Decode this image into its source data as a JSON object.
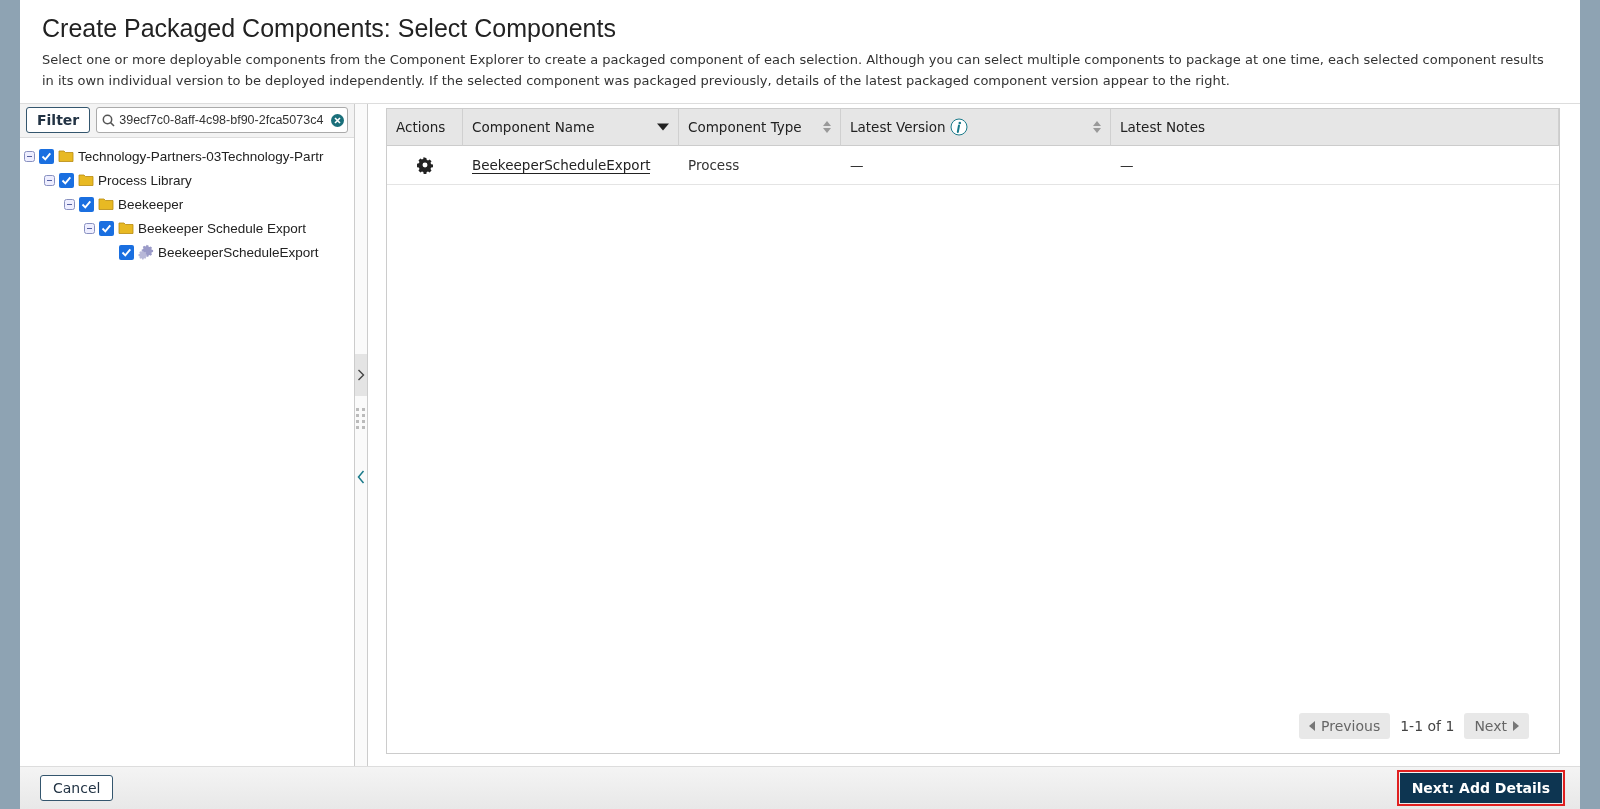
{
  "dialog": {
    "title": "Create Packaged Components: Select Components",
    "description": "Select one or more deployable components from the Component Explorer to create a packaged component of each selection. Although you can select multiple components to package at one time, each selected component results in its own individual version to be deployed independently. If the selected component was packaged previously, details of the latest packaged component version appear to the right."
  },
  "explorer": {
    "filter_button": "Filter",
    "search": {
      "value": "39ecf7c0-8aff-4c98-bf90-2fca5073c4"
    },
    "tree": [
      {
        "label": "Technology-Partners-03Technology-Partr",
        "kind": "folder",
        "checked": true,
        "expanded": true,
        "children": [
          {
            "label": "Process Library",
            "kind": "folder",
            "checked": true,
            "expanded": true,
            "children": [
              {
                "label": "Beekeeper",
                "kind": "folder",
                "checked": true,
                "expanded": true,
                "children": [
                  {
                    "label": "Beekeeper Schedule Export",
                    "kind": "folder",
                    "checked": true,
                    "expanded": true,
                    "children": [
                      {
                        "label": "BeekeeperScheduleExport",
                        "kind": "process",
                        "checked": true,
                        "expanded": false
                      }
                    ]
                  }
                ]
              }
            ]
          }
        ]
      }
    ]
  },
  "table": {
    "columns": [
      {
        "label": "Actions",
        "sortable": false
      },
      {
        "label": "Component Name",
        "sortable": true,
        "sorted_descending": true
      },
      {
        "label": "Component Type",
        "sortable": true,
        "sorted_descending": false
      },
      {
        "label": "Latest Version",
        "sortable": true,
        "sorted_descending": false,
        "info": true
      },
      {
        "label": "Latest Notes",
        "sortable": false
      }
    ],
    "rows": [
      {
        "name": "BeekeeperScheduleExport",
        "type": "Process",
        "latest_version": "—",
        "latest_notes": "—"
      }
    ]
  },
  "pagination": {
    "previous": "Previous",
    "range": "1-1 of 1",
    "next": "Next"
  },
  "footer": {
    "cancel": "Cancel",
    "next": "Next: Add Details"
  }
}
